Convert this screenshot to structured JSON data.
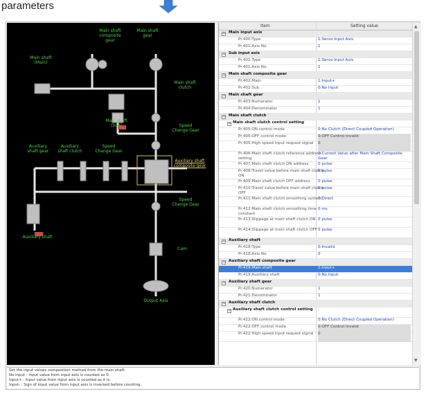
{
  "caption": "parameters",
  "colors": {
    "diagram_bg": "#000000",
    "diagram_label": "#4fd14f",
    "selected_row": "#3b7dd8",
    "value_text": "#1c3fa8",
    "arrow": "#3d7fd0"
  },
  "diagram": {
    "labels": {
      "main_shaft_composite_gear": "Main shaft composite gear",
      "main_shaft_gear": "Main shaft gear",
      "main_shaft_main": "Main shaft (Main)",
      "main_shaft_clutch": "Main shaft clutch",
      "main_shaft_sub": "Main shaft (Sub)",
      "speed_change_gear_1": "Speed Change Gear",
      "auxiliary_shaft_gear": "Auxiliary shaft gear",
      "auxiliary_shaft_clutch": "Auxiliary shaft clutch",
      "speed_change_gear_2": "Speed Change Gear",
      "auxiliary_shaft_composite_gear": "Auxiliary shaft composite gear",
      "speed_change_gear_3": "Speed Change Gear",
      "auxiliary_shaft": "Auxiliary shaft",
      "cam": "Cam",
      "output_axis": "Output Axis"
    }
  },
  "grid": {
    "headers": {
      "item": "Item",
      "value": "Setting value"
    },
    "rows": [
      {
        "kind": "cat",
        "name": "Main input axis",
        "value": "",
        "exp": "−"
      },
      {
        "kind": "leaf",
        "name": "Pr.400:Type",
        "value": "1:Servo Input Axis"
      },
      {
        "kind": "leaf",
        "name": "Pr.401:Axis No.",
        "value": "1"
      },
      {
        "kind": "cat",
        "name": "Sub input axis",
        "value": "",
        "exp": "−"
      },
      {
        "kind": "leaf",
        "name": "Pr.401:Type",
        "value": "1:Servo Input Axis"
      },
      {
        "kind": "leaf",
        "name": "Pr.401:Axis No.",
        "value": "1"
      },
      {
        "kind": "cat",
        "name": "Main shaft composite gear",
        "value": "",
        "exp": "−"
      },
      {
        "kind": "leaf",
        "name": "Pr.402:Main",
        "value": "1:Input+"
      },
      {
        "kind": "leaf",
        "name": "Pr.402:Sub",
        "value": "0:No Input"
      },
      {
        "kind": "cat",
        "name": "Main shaft gear",
        "value": "",
        "exp": "−"
      },
      {
        "kind": "leaf",
        "name": "Pr.403:Numerator",
        "value": "1"
      },
      {
        "kind": "leaf",
        "name": "Pr.404:Denominator",
        "value": "1"
      },
      {
        "kind": "cat",
        "name": "Main shaft clutch",
        "value": "",
        "exp": "−"
      },
      {
        "kind": "sub",
        "name": "Main shaft clutch control setting",
        "value": "",
        "exp": "−"
      },
      {
        "kind": "leaf",
        "name": "Pr.405:ON control mode",
        "value": "0:No Clutch (Direct Coupled Operation)"
      },
      {
        "kind": "leaf disabled",
        "name": "Pr.405:OFF control mode",
        "value": "0:OFF Control Invalid"
      },
      {
        "kind": "leaf disabled",
        "name": "Pr.405:High speed input request signal",
        "value": "0",
        "tall": true
      },
      {
        "kind": "leaf",
        "name": "Pr.406:Main shaft clutch reference address setting",
        "value": "0:Current Value after Main Shaft Composite Gear",
        "tall": true
      },
      {
        "kind": "leaf",
        "name": "Pr.407:Main shaft clutch ON address",
        "value": "0 pulse"
      },
      {
        "kind": "leaf",
        "name": "Pr.408:Travel value before main shaft clutch ON",
        "value": "0 pulse",
        "tall": true
      },
      {
        "kind": "leaf",
        "name": "Pr.409:Main shaft clutch OFF address",
        "value": "0 pulse"
      },
      {
        "kind": "leaf",
        "name": "Pr.410:Travel value before main shaft clutch OFF",
        "value": "0 pulse",
        "tall": true
      },
      {
        "kind": "leaf",
        "name": "Pr.411:Main shaft clutch smoothing system",
        "value": "0:Direct",
        "tall": true
      },
      {
        "kind": "leaf",
        "name": "Pr.412:Main shaft clutch smoothing time constant",
        "value": "0 ms",
        "tall": true
      },
      {
        "kind": "leaf",
        "name": "Pr.413:Slippage at main shaft clutch ON",
        "value": "0 pulse",
        "tall": true
      },
      {
        "kind": "leaf",
        "name": "Pr.414:Slippage at main shaft clutch OFF",
        "value": "0 pulse",
        "tall": true
      },
      {
        "kind": "cat",
        "name": "Auxiliary shaft",
        "value": "",
        "exp": "−"
      },
      {
        "kind": "leaf",
        "name": "Pr.418:Type",
        "value": "0:Invalid"
      },
      {
        "kind": "leaf",
        "name": "Pr.418:Axis No.",
        "value": "0"
      },
      {
        "kind": "cat",
        "name": "Auxiliary shaft composite gear",
        "value": "",
        "exp": "−"
      },
      {
        "kind": "leaf selected",
        "name": "Pr.419:Main shaft",
        "value": "1:Input+"
      },
      {
        "kind": "leaf",
        "name": "Pr.419:Auxiliary shaft",
        "value": "0:No Input"
      },
      {
        "kind": "cat",
        "name": "Auxiliary shaft gear",
        "value": "",
        "exp": "−"
      },
      {
        "kind": "leaf",
        "name": "Pr.420:Numerator",
        "value": "1"
      },
      {
        "kind": "leaf",
        "name": "Pr.421:Denominator",
        "value": "1"
      },
      {
        "kind": "cat",
        "name": "Auxiliary shaft clutch",
        "value": "",
        "exp": "−"
      },
      {
        "kind": "sub",
        "name": "Auxiliary shaft clutch control setting",
        "value": "",
        "exp": "−",
        "tall": true
      },
      {
        "kind": "leaf",
        "name": "Pr.422:ON control mode",
        "value": "0:No Clutch (Direct Coupled Operation)"
      },
      {
        "kind": "leaf disabled",
        "name": "Pr.422:OFF control mode",
        "value": "0:OFF Control Invalid"
      },
      {
        "kind": "leaf disabled",
        "name": "Pr.422:High speed input request signal",
        "value": "0",
        "tall": true
      }
    ]
  },
  "description": {
    "line1": "Set the input values composition method from the main shaft.",
    "line2": "No Input : Input value from input axis is counted as 0.",
    "line3": "Input+ : Input value from input axis is counted as it is.",
    "line4": "Input- : Sign of input value from input axis is inversed before counting."
  }
}
